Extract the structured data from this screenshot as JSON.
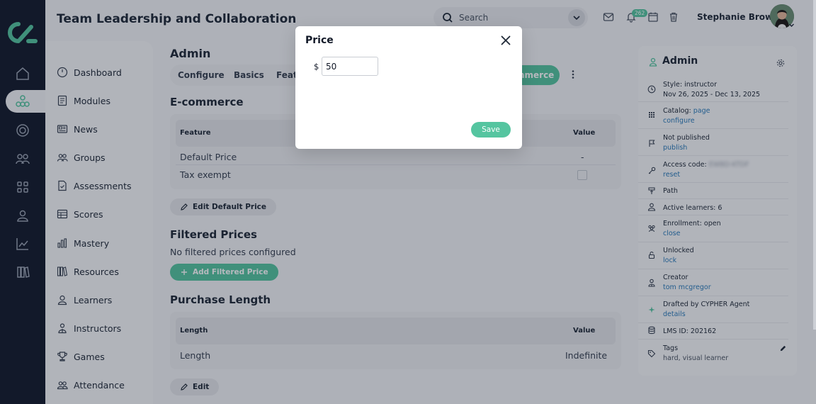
{
  "header": {
    "title": "Team Leadership and Collaboration",
    "search_placeholder": "Search",
    "notification_count": "262",
    "user_name": "Stephanie Brown"
  },
  "sidebar": {
    "items": [
      {
        "label": "Dashboard"
      },
      {
        "label": "Modules"
      },
      {
        "label": "News"
      },
      {
        "label": "Groups"
      },
      {
        "label": "Assessments"
      },
      {
        "label": "Scores"
      },
      {
        "label": "Mastery"
      },
      {
        "label": "Resources"
      },
      {
        "label": "Learners"
      },
      {
        "label": "Instructors"
      },
      {
        "label": "Games"
      },
      {
        "label": "Attendance"
      }
    ]
  },
  "main": {
    "title": "Admin",
    "tabs": [
      {
        "label": "Configure"
      },
      {
        "label": "Basics"
      },
      {
        "label": "Featu"
      }
    ],
    "active_tab": "mmerce",
    "ecommerce": {
      "title": "E-commerce",
      "headers": {
        "feature": "Feature",
        "value": "Value"
      },
      "rows": [
        {
          "feature": "Default Price",
          "value": "-"
        },
        {
          "feature": "Tax exempt",
          "value": ""
        }
      ],
      "edit_button": "Edit Default Price"
    },
    "filtered": {
      "title": "Filtered Prices",
      "empty_text": "No filtered prices configured",
      "add_button": "Add Filtered Price"
    },
    "purchase": {
      "title": "Purchase Length",
      "headers": {
        "length": "Length",
        "value": "Value"
      },
      "rows": [
        {
          "length": "Length",
          "value": "Indefinite"
        }
      ],
      "edit_button": "Edit"
    }
  },
  "right_panel": {
    "title": "Admin",
    "style": "Style: instructor",
    "dates": "Nov 26, 2025 - Dec 13, 2025",
    "catalog_label": "Catalog:",
    "catalog_link": "page",
    "catalog_configure": "configure",
    "publish_status": "Not published",
    "publish_link": "publish",
    "access_label": "Access code:",
    "access_code": "EWBD-KTDF",
    "reset_link": "reset",
    "path": "Path",
    "active_learners": "Active learners: 6",
    "enrollment": "Enrollment: open",
    "close_link": "close",
    "lock_status": "Unlocked",
    "lock_link": "lock",
    "creator_label": "Creator",
    "creator_link": "tom mcgregor",
    "drafted": "Drafted by CYPHER Agent",
    "details_link": "details",
    "lms_id": "LMS ID: 202162",
    "tags_label": "Tags",
    "tags": "hard, visual learner"
  },
  "modal": {
    "title": "Price",
    "currency": "$",
    "value": "50",
    "save": "Save"
  },
  "colors": {
    "accent": "#55c5a0",
    "rail": "#131a2b",
    "link": "#2b7bb9"
  }
}
